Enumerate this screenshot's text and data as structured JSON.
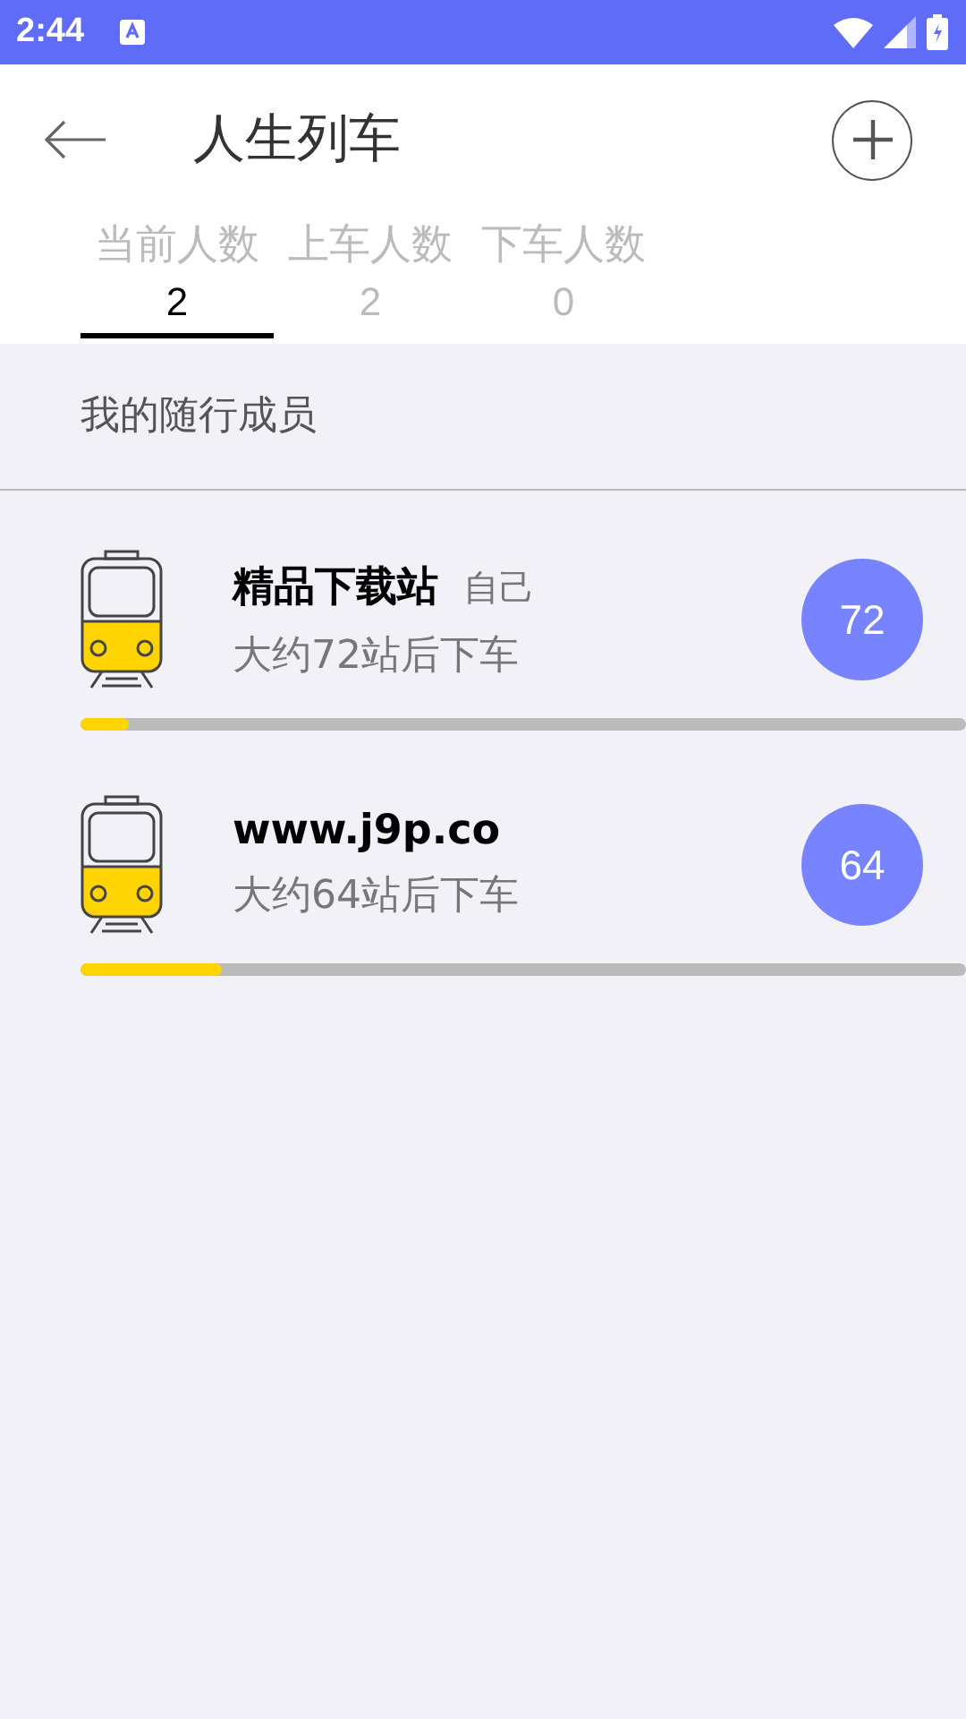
{
  "status_bar": {
    "time": "2:44"
  },
  "header": {
    "title": "人生列车"
  },
  "tabs": [
    {
      "label": "当前人数",
      "count": "2",
      "selected": true
    },
    {
      "label": "上车人数",
      "count": "2",
      "selected": false
    },
    {
      "label": "下车人数",
      "count": "0",
      "selected": false
    }
  ],
  "section_title": "我的随行成员",
  "members": [
    {
      "name": "精品下载站",
      "tag": "自己",
      "subtitle": "大约72站后下车",
      "badge": "72",
      "level": 0.055
    },
    {
      "name": "www.j9p.co",
      "subtitle": "大约64站后下车",
      "badge": "64",
      "level": 0.16
    }
  ]
}
